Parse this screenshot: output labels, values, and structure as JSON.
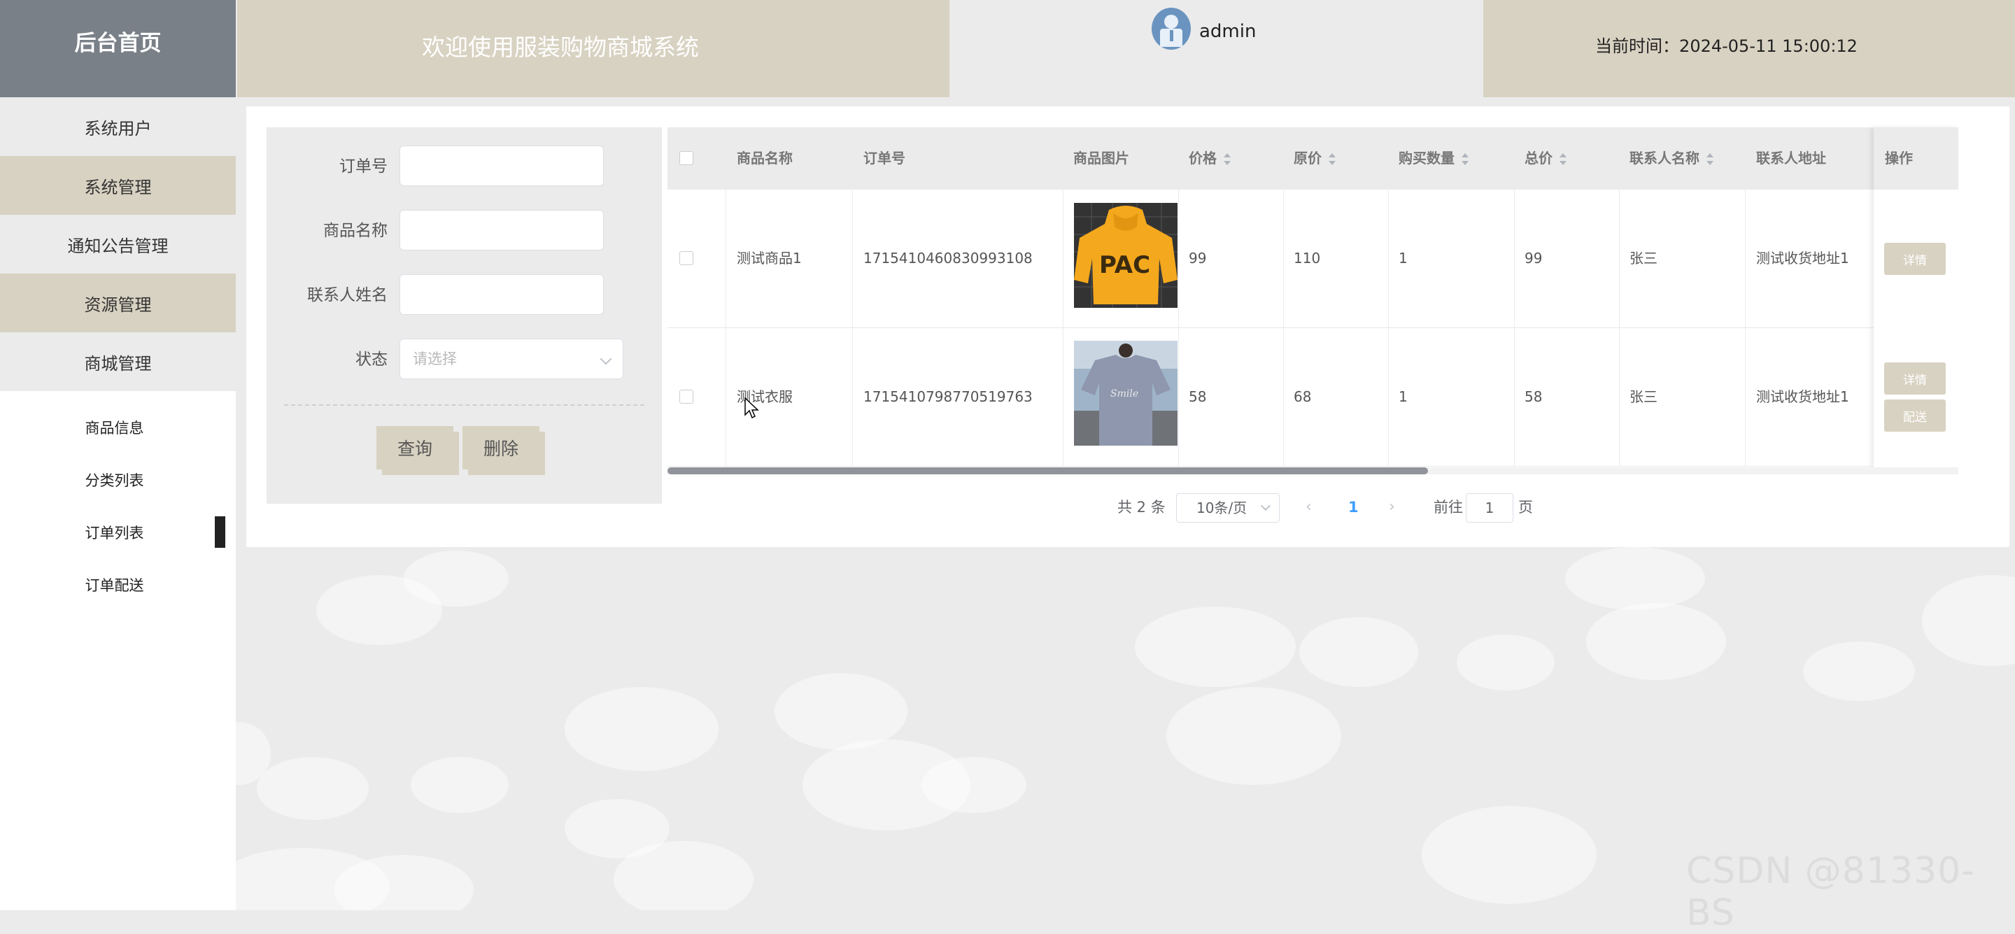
{
  "header": {
    "logo": "后台首页",
    "welcome": "欢迎使用服装购物商城系统",
    "username": "admin",
    "current_time": "当前时间：2024-05-11 15:00:12"
  },
  "sidebar": {
    "items": [
      {
        "label": "系统用户"
      },
      {
        "label": "系统管理"
      },
      {
        "label": "通知公告管理"
      },
      {
        "label": "资源管理"
      },
      {
        "label": "商城管理"
      }
    ],
    "sub_items": [
      {
        "label": "商品信息"
      },
      {
        "label": "分类列表"
      },
      {
        "label": "订单列表",
        "active": true
      },
      {
        "label": "订单配送"
      }
    ]
  },
  "search": {
    "order_no_label": "订单号",
    "product_name_label": "商品名称",
    "contact_name_label": "联系人姓名",
    "status_label": "状态",
    "status_placeholder": "请选择",
    "query_button": "查询",
    "delete_button": "删除"
  },
  "table": {
    "columns": [
      "商品名称",
      "订单号",
      "商品图片",
      "价格",
      "原价",
      "购买数量",
      "总价",
      "联系人名称",
      "联系人地址",
      "操作"
    ],
    "rows": [
      {
        "name": "测试商品1",
        "order_no": "1715410460830993108",
        "price": "99",
        "original_price": "110",
        "quantity": "1",
        "total": "99",
        "contact": "张三",
        "address": "测试收货地址1",
        "actions": [
          "详情"
        ]
      },
      {
        "name": "测试衣服",
        "order_no": "1715410798770519763",
        "price": "58",
        "original_price": "68",
        "quantity": "1",
        "total": "58",
        "contact": "张三",
        "address": "测试收货地址1",
        "actions": [
          "详情",
          "配送"
        ]
      }
    ]
  },
  "pagination": {
    "total": "共 2 条",
    "page_size": "10条/页",
    "current_page": "1",
    "goto_label": "前往",
    "goto_value": "1",
    "page_suffix": "页"
  },
  "watermark": "CSDN @81330-BS",
  "colors": {
    "accent": "#d8d2c2",
    "logo_bg": "#7a8088",
    "page_bg": "#ebebeb"
  }
}
